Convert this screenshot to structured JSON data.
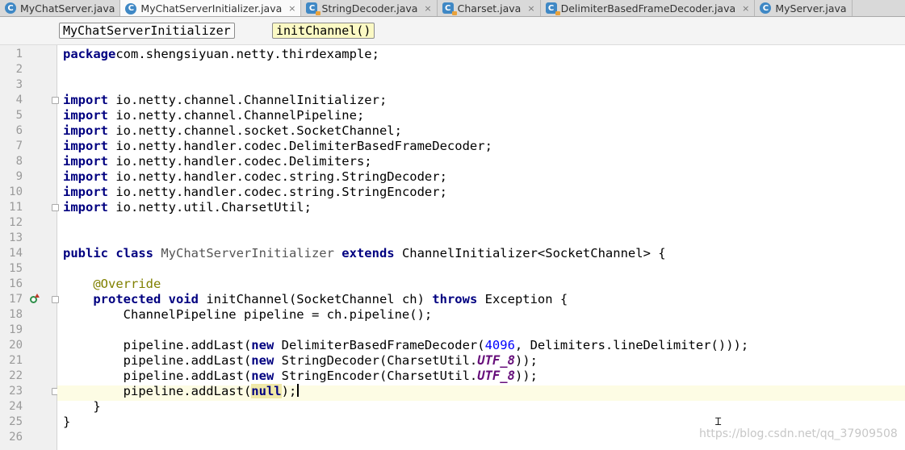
{
  "tabs": [
    {
      "label": "MyChatServer.java",
      "icon": "class-c-icon",
      "active": false,
      "closable": false
    },
    {
      "label": "MyChatServerInitializer.java",
      "icon": "class-c-icon",
      "active": true,
      "closable": true
    },
    {
      "label": "StringDecoder.java",
      "icon": "library-class-icon",
      "active": false,
      "closable": true
    },
    {
      "label": "Charset.java",
      "icon": "library-class-icon",
      "active": false,
      "closable": true
    },
    {
      "label": "DelimiterBasedFrameDecoder.java",
      "icon": "library-class-icon",
      "active": false,
      "closable": true
    },
    {
      "label": "MyServer.java",
      "icon": "class-c-icon",
      "active": false,
      "closable": false
    }
  ],
  "tab_close_glyph": "×",
  "class_icon_letter": "C",
  "breadcrumb": {
    "class_name": "MyChatServerInitializer",
    "method_name": "initChannel()"
  },
  "colors": {
    "keyword": "#000080",
    "annotation": "#808000",
    "number": "#0000ff",
    "static_field": "#660e7a",
    "current_line": "#fdfce4"
  },
  "editor": {
    "current_line": 23,
    "lines": [
      {
        "n": "1",
        "tokens": [
          [
            "kw",
            "package"
          ],
          [
            "",
            "com.shengsiyuan.netty.thirdexample;"
          ]
        ]
      },
      {
        "n": "2",
        "tokens": []
      },
      {
        "n": "3",
        "tokens": []
      },
      {
        "n": "4",
        "tokens": [
          [
            "kw",
            "import"
          ],
          [
            "",
            " io.netty.channel.ChannelInitializer;"
          ]
        ]
      },
      {
        "n": "5",
        "tokens": [
          [
            "kw",
            "import"
          ],
          [
            "",
            " io.netty.channel.ChannelPipeline;"
          ]
        ]
      },
      {
        "n": "6",
        "tokens": [
          [
            "kw",
            "import"
          ],
          [
            "",
            " io.netty.channel.socket.SocketChannel;"
          ]
        ]
      },
      {
        "n": "7",
        "tokens": [
          [
            "kw",
            "import"
          ],
          [
            "",
            " io.netty.handler.codec.DelimiterBasedFrameDecoder;"
          ]
        ]
      },
      {
        "n": "8",
        "tokens": [
          [
            "kw",
            "import"
          ],
          [
            "",
            " io.netty.handler.codec.Delimiters;"
          ]
        ]
      },
      {
        "n": "9",
        "tokens": [
          [
            "kw",
            "import"
          ],
          [
            "",
            " io.netty.handler.codec.string.StringDecoder;"
          ]
        ]
      },
      {
        "n": "10",
        "tokens": [
          [
            "kw",
            "import"
          ],
          [
            "",
            " io.netty.handler.codec.string.StringEncoder;"
          ]
        ]
      },
      {
        "n": "11",
        "tokens": [
          [
            "kw",
            "import"
          ],
          [
            "",
            " io.netty.util.CharsetUtil;"
          ]
        ]
      },
      {
        "n": "12",
        "tokens": []
      },
      {
        "n": "13",
        "tokens": []
      },
      {
        "n": "14",
        "tokens": [
          [
            "kw",
            "public class "
          ],
          [
            "gray",
            "MyChatServerInitializer "
          ],
          [
            "kw",
            "extends"
          ],
          [
            "",
            " ChannelInitializer<SocketChannel> {"
          ]
        ]
      },
      {
        "n": "15",
        "tokens": []
      },
      {
        "n": "16",
        "tokens": [
          [
            "",
            "    "
          ],
          [
            "an",
            "@Override"
          ]
        ]
      },
      {
        "n": "17",
        "tokens": [
          [
            "",
            "    "
          ],
          [
            "kw",
            "protected void"
          ],
          [
            "",
            " initChannel(SocketChannel ch) "
          ],
          [
            "kw",
            "throws"
          ],
          [
            "",
            " Exception {"
          ]
        ]
      },
      {
        "n": "18",
        "tokens": [
          [
            "",
            "        ChannelPipeline pipeline = ch.pipeline();"
          ]
        ]
      },
      {
        "n": "19",
        "tokens": []
      },
      {
        "n": "20",
        "tokens": [
          [
            "",
            "        pipeline.addLast("
          ],
          [
            "kw",
            "new"
          ],
          [
            "",
            " DelimiterBasedFrameDecoder("
          ],
          [
            "num",
            "4096"
          ],
          [
            "",
            ", Delimiters.lineDelimiter()));"
          ]
        ]
      },
      {
        "n": "21",
        "tokens": [
          [
            "",
            "        pipeline.addLast("
          ],
          [
            "kw",
            "new"
          ],
          [
            "",
            " StringDecoder(CharsetUtil."
          ],
          [
            "st",
            "UTF_8"
          ],
          [
            "",
            "));"
          ]
        ]
      },
      {
        "n": "22",
        "tokens": [
          [
            "",
            "        pipeline.addLast("
          ],
          [
            "kw",
            "new"
          ],
          [
            "",
            " StringEncoder(CharsetUtil."
          ],
          [
            "st",
            "UTF_8"
          ],
          [
            "",
            "));"
          ]
        ]
      },
      {
        "n": "23",
        "tokens": [
          [
            "",
            "        pipeline.addLast("
          ],
          [
            "kw nullbox",
            "null"
          ],
          [
            "",
            ");"
          ],
          [
            "cursor",
            ""
          ]
        ]
      },
      {
        "n": "24",
        "tokens": [
          [
            "",
            "    }"
          ]
        ]
      },
      {
        "n": "25",
        "tokens": [
          [
            "",
            "}"
          ]
        ]
      },
      {
        "n": "26",
        "tokens": []
      }
    ],
    "fold_marker_lines": [
      4,
      11,
      17,
      23
    ],
    "gutter_marker_line": 17
  },
  "mouse_cursor_glyph": "Ɪ",
  "watermark": "https://blog.csdn.net/qq_37909508"
}
